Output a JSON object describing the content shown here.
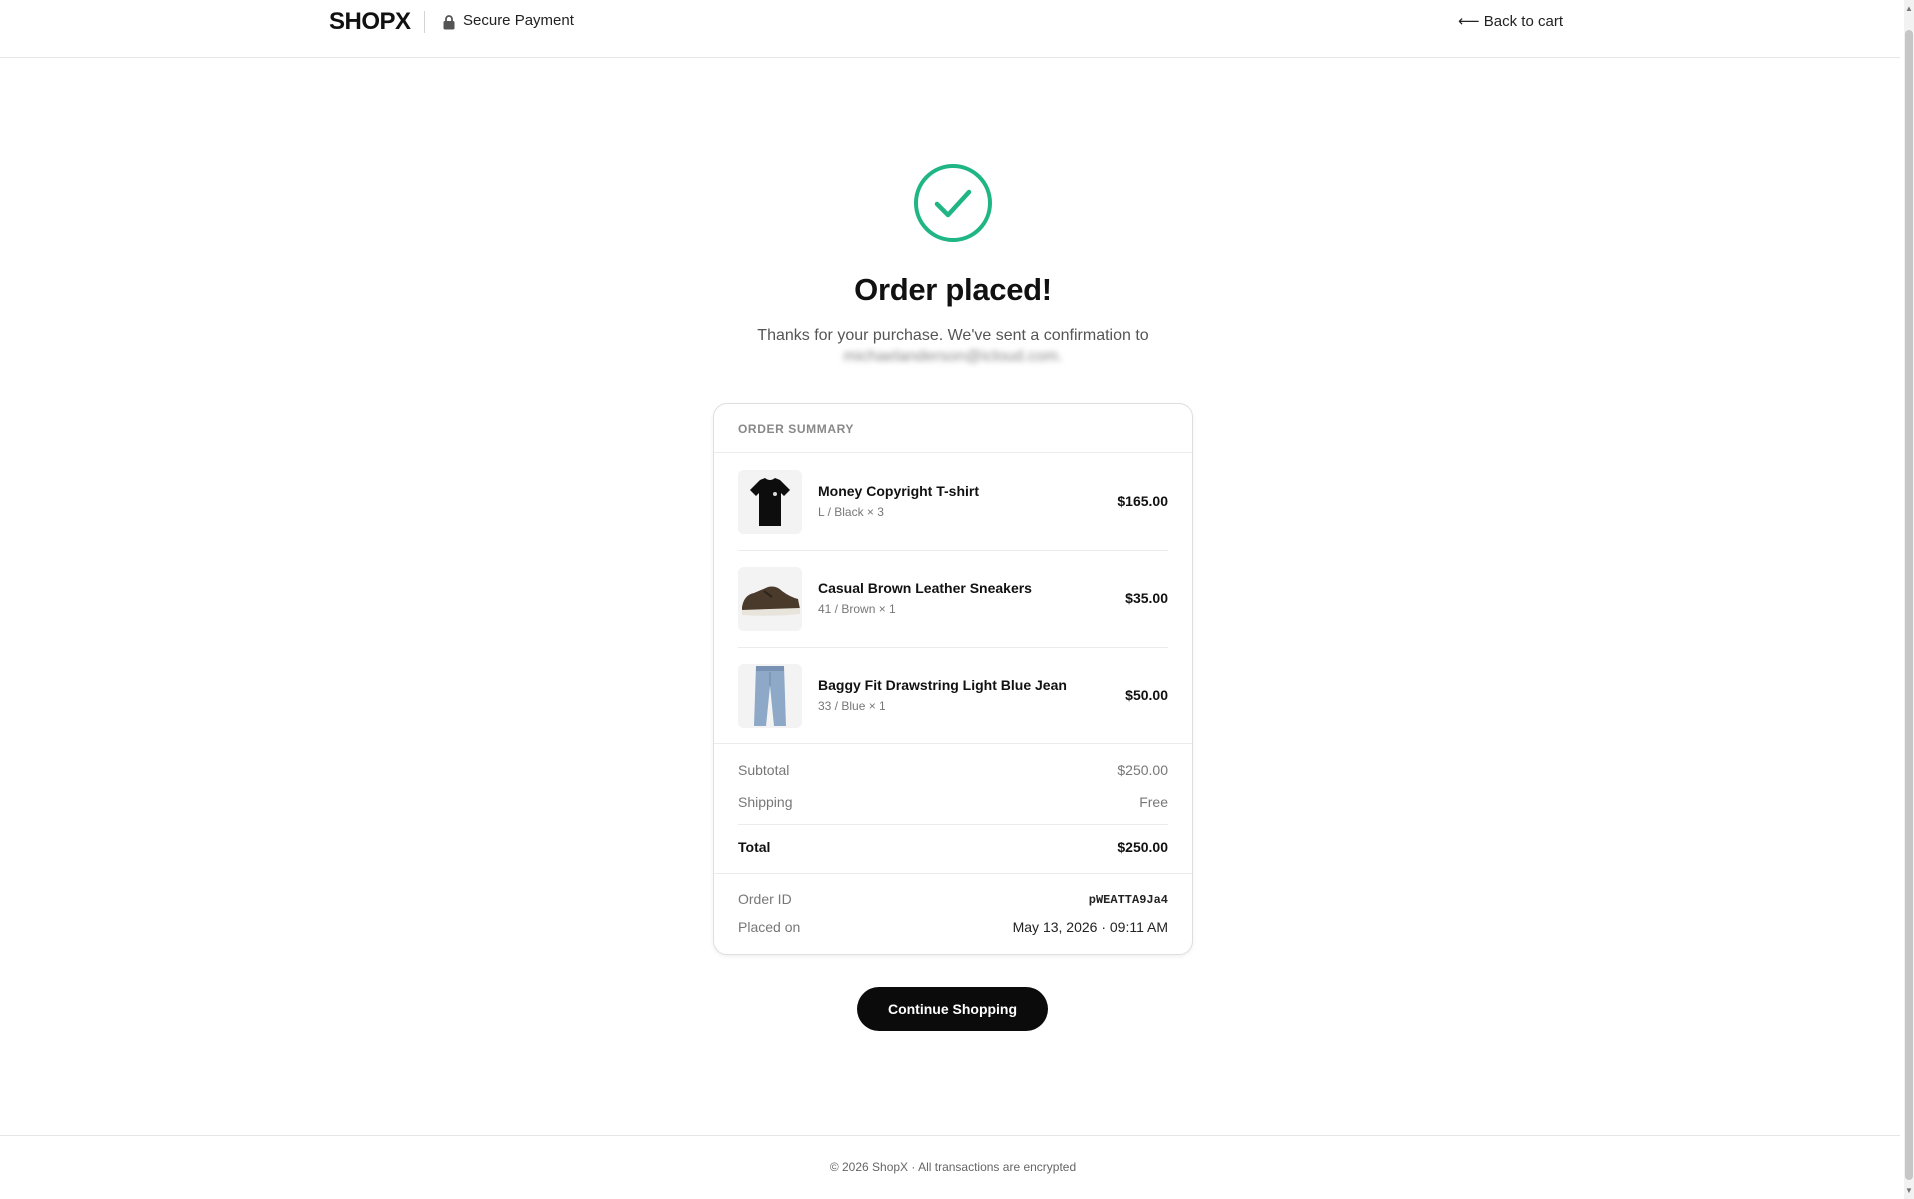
{
  "header": {
    "logo": "SHOPX",
    "secure_label": "Secure Payment",
    "back_label": "⟵ Back to cart"
  },
  "confirmation": {
    "title": "Order placed!",
    "message": "Thanks for your purchase. We've sent a confirmation to",
    "email": "michaelanderson@icloud.com."
  },
  "summary": {
    "heading": "ORDER SUMMARY",
    "items": [
      {
        "name": "Money Copyright T-shirt",
        "variant": "L / Black × 3",
        "price": "$165.00",
        "thumb_icon": "tshirt-thumbnail"
      },
      {
        "name": "Casual Brown Leather Sneakers",
        "variant": "41 / Brown × 1",
        "price": "$35.00",
        "thumb_icon": "sneaker-thumbnail"
      },
      {
        "name": "Baggy Fit Drawstring Light Blue Jean",
        "variant": "33 / Blue × 1",
        "price": "$50.00",
        "thumb_icon": "jeans-thumbnail"
      }
    ],
    "subtotal_label": "Subtotal",
    "subtotal_value": "$250.00",
    "shipping_label": "Shipping",
    "shipping_value": "Free",
    "total_label": "Total",
    "total_value": "$250.00",
    "order_id_label": "Order ID",
    "order_id_value": "pWEATTA9Ja4",
    "placed_on_label": "Placed on",
    "placed_on_value": "May 13, 2026 · 09:11 AM"
  },
  "actions": {
    "continue_label": "Continue Shopping"
  },
  "footer": {
    "text": "© 2026 ShopX · All transactions are encrypted"
  },
  "colors": {
    "success_green": "#1fb584",
    "button_black": "#0b0b0b"
  }
}
